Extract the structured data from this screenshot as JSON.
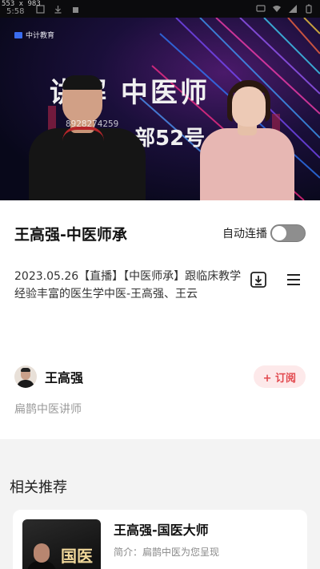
{
  "status_bar": {
    "resolution": "553 x 983",
    "time": "5:58"
  },
  "video": {
    "logo_text": "中计教育",
    "headline": "讲解  中医师",
    "subline": "部52号",
    "watermark": "8928274259"
  },
  "header": {
    "title": "王高强-中医师承",
    "autoplay_label": "自动连播",
    "autoplay_on": false
  },
  "description": {
    "text": "2023.05.26【直播】【中医师承】跟临床教学经验丰富的医生学中医-王高强、王云"
  },
  "author": {
    "name": "王高强",
    "subscribe_label": "+ 订阅",
    "bio": "扁鹊中医讲师"
  },
  "recommend": {
    "section_title": "相关推荐",
    "items": [
      {
        "title": "王高强-国医大师",
        "intro": "简介：扁鹊中医为您呈现",
        "thumb_text": "国医"
      }
    ]
  },
  "icons": {
    "download": "download-icon",
    "menu": "menu-icon"
  },
  "colors": {
    "accent": "#e2484d",
    "subscribe_bg": "#fde9ea",
    "toggle_off": "#8e8e8e"
  }
}
